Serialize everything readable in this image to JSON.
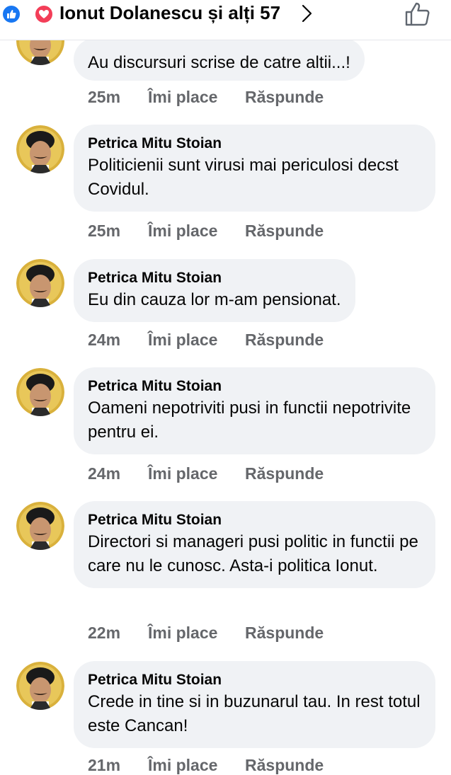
{
  "header": {
    "title": "Ionut Dolanescu și alți 57",
    "reactions": [
      "like-icon",
      "love-icon"
    ],
    "colors": {
      "like": "#1877f2",
      "love": "#f33e58"
    }
  },
  "actions": {
    "like_label": "Îmi place",
    "reply_label": "Răspunde"
  },
  "comments": [
    {
      "author": "",
      "text": "Au discursuri scrise de catre altii...!",
      "time": "25m"
    },
    {
      "author": "Petrica Mitu Stoian",
      "text": "Politicienii sunt virusi mai periculosi decst Covidul.",
      "time": "25m"
    },
    {
      "author": "Petrica Mitu Stoian",
      "text": "Eu din cauza lor m-am pensionat.",
      "time": "24m"
    },
    {
      "author": "Petrica Mitu Stoian",
      "text": "Oameni nepotriviti pusi in functii nepotrivite pentru ei.",
      "time": "24m"
    },
    {
      "author": "Petrica Mitu Stoian",
      "text": "Directori si manageri pusi politic in functii pe care nu le cunosc. Asta-i politica Ionut.",
      "time": "22m"
    },
    {
      "author": "Petrica Mitu Stoian",
      "text": "Crede in tine si in buzunarul tau. In rest totul este Cancan!",
      "time": "21m"
    }
  ]
}
